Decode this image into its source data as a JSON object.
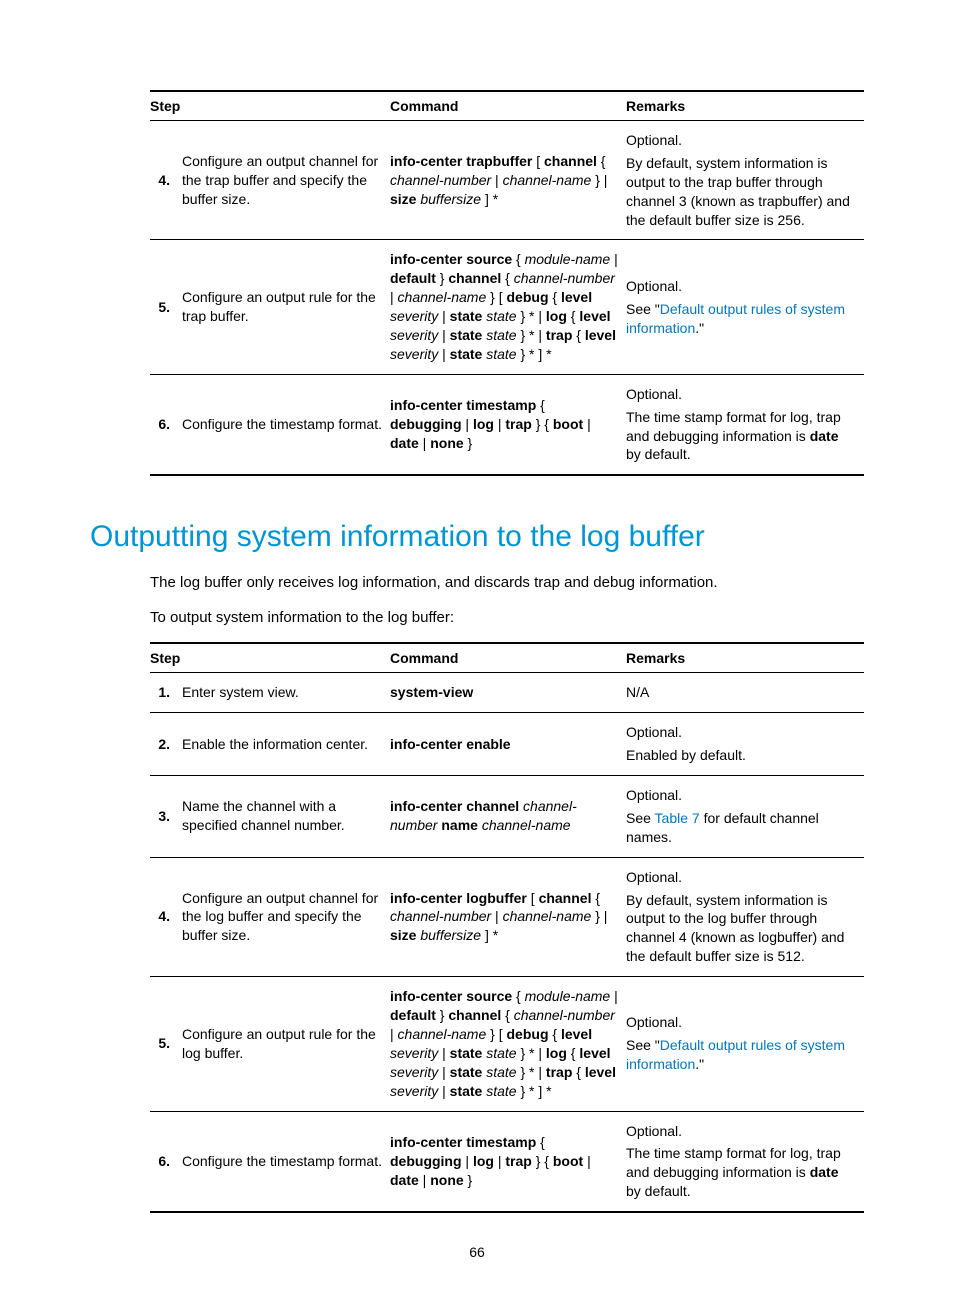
{
  "table1": {
    "headers": {
      "step": "Step",
      "command": "Command",
      "remarks": "Remarks"
    },
    "rows": [
      {
        "num": "4.",
        "desc": "Configure an output channel for the trap buffer and specify the buffer size.",
        "cmd": {
          "tokens": [
            {
              "t": "info-center trapbuffer",
              "b": 1
            },
            {
              "t": " [ "
            },
            {
              "t": "channel",
              "b": 1
            },
            {
              "t": " { "
            },
            {
              "t": "channel-number",
              "i": 1
            },
            {
              "t": " | "
            },
            {
              "t": "channel-name",
              "i": 1
            },
            {
              "t": " } "
            },
            {
              "t": " | "
            },
            {
              "t": "size",
              "b": 1
            },
            {
              "t": " "
            },
            {
              "t": "buffersize",
              "i": 1
            },
            {
              "t": " ] *"
            }
          ]
        },
        "remarks": [
          {
            "type": "p",
            "text": "Optional."
          },
          {
            "type": "p",
            "text": "By default, system information is output to the trap buffer through channel 3 (known as trapbuffer) and the default buffer size is 256."
          }
        ]
      },
      {
        "num": "5.",
        "desc": "Configure an output rule for the trap buffer.",
        "cmd": {
          "tokens": [
            {
              "t": "info-center source",
              "b": 1
            },
            {
              "t": " { "
            },
            {
              "t": "module-name",
              "i": 1
            },
            {
              "t": " | "
            },
            {
              "t": "default",
              "b": 1
            },
            {
              "t": " } "
            },
            {
              "t": "channel",
              "b": 1
            },
            {
              "t": " { "
            },
            {
              "t": "channel-number",
              "i": 1
            },
            {
              "t": " | "
            },
            {
              "t": "channel-name",
              "i": 1
            },
            {
              "t": " } [ "
            },
            {
              "t": "debug",
              "b": 1
            },
            {
              "t": " { "
            },
            {
              "t": "level",
              "b": 1
            },
            {
              "t": " "
            },
            {
              "t": "severity",
              "i": 1
            },
            {
              "t": " | "
            },
            {
              "t": "state",
              "b": 1
            },
            {
              "t": " "
            },
            {
              "t": "state",
              "i": 1
            },
            {
              "t": " } * | "
            },
            {
              "t": "log",
              "b": 1
            },
            {
              "t": " { "
            },
            {
              "t": "level",
              "b": 1
            },
            {
              "t": " "
            },
            {
              "t": "severity",
              "i": 1
            },
            {
              "t": " | "
            },
            {
              "t": "state",
              "b": 1
            },
            {
              "t": " "
            },
            {
              "t": "state",
              "i": 1
            },
            {
              "t": " } * | "
            },
            {
              "t": "trap",
              "b": 1
            },
            {
              "t": " { "
            },
            {
              "t": "level",
              "b": 1
            },
            {
              "t": " "
            },
            {
              "t": "severity",
              "i": 1
            },
            {
              "t": " | "
            },
            {
              "t": "state",
              "b": 1
            },
            {
              "t": " "
            },
            {
              "t": "state",
              "i": 1
            },
            {
              "t": " } * ] *"
            }
          ]
        },
        "remarks": [
          {
            "type": "p",
            "text": "Optional."
          },
          {
            "type": "mixed",
            "parts": [
              {
                "text": "See \""
              },
              {
                "text": "Default output rules of system information",
                "link": true
              },
              {
                "text": ".\""
              }
            ]
          }
        ]
      },
      {
        "num": "6.",
        "desc": "Configure the timestamp format.",
        "cmd": {
          "tokens": [
            {
              "t": "info-center timestamp",
              "b": 1
            },
            {
              "t": " { "
            },
            {
              "t": "debugging",
              "b": 1
            },
            {
              "t": " | "
            },
            {
              "t": "log",
              "b": 1
            },
            {
              "t": " | "
            },
            {
              "t": "trap",
              "b": 1
            },
            {
              "t": " } { "
            },
            {
              "t": "boot",
              "b": 1
            },
            {
              "t": " | "
            },
            {
              "t": "date",
              "b": 1
            },
            {
              "t": " | "
            },
            {
              "t": "none",
              "b": 1
            },
            {
              "t": " }"
            }
          ]
        },
        "remarks": [
          {
            "type": "p",
            "text": "Optional."
          },
          {
            "type": "mixed",
            "parts": [
              {
                "text": "The time stamp format for log, trap and debugging information is "
              },
              {
                "text": "date",
                "b": true
              },
              {
                "text": " by default."
              }
            ]
          }
        ]
      }
    ]
  },
  "heading": "Outputting system information to the log buffer",
  "para1": "The log buffer only receives log information, and discards trap and debug information.",
  "para2": "To output system information to the log buffer:",
  "table2": {
    "headers": {
      "step": "Step",
      "command": "Command",
      "remarks": "Remarks"
    },
    "rows": [
      {
        "num": "1.",
        "desc": "Enter system view.",
        "cmd": {
          "tokens": [
            {
              "t": "system-view",
              "b": 1
            }
          ]
        },
        "remarks": [
          {
            "type": "p",
            "text": "N/A"
          }
        ]
      },
      {
        "num": "2.",
        "desc": "Enable the information center.",
        "cmd": {
          "tokens": [
            {
              "t": "info-center enable",
              "b": 1
            }
          ]
        },
        "remarks": [
          {
            "type": "p",
            "text": "Optional."
          },
          {
            "type": "p",
            "text": "Enabled by default."
          }
        ]
      },
      {
        "num": "3.",
        "desc": "Name the channel with a specified channel number.",
        "cmd": {
          "tokens": [
            {
              "t": "info-center channel",
              "b": 1
            },
            {
              "t": " "
            },
            {
              "t": "channel-number",
              "i": 1
            },
            {
              "t": " "
            },
            {
              "t": "name",
              "b": 1
            },
            {
              "t": " "
            },
            {
              "t": "channel-name",
              "i": 1
            }
          ]
        },
        "remarks": [
          {
            "type": "p",
            "text": "Optional."
          },
          {
            "type": "mixed",
            "parts": [
              {
                "text": "See "
              },
              {
                "text": "Table 7",
                "link": true
              },
              {
                "text": " for default channel names."
              }
            ]
          }
        ]
      },
      {
        "num": "4.",
        "desc": "Configure an output channel for the log buffer and specify the buffer size.",
        "cmd": {
          "tokens": [
            {
              "t": "info-center logbuffer",
              "b": 1
            },
            {
              "t": " [ "
            },
            {
              "t": "channel",
              "b": 1
            },
            {
              "t": " { "
            },
            {
              "t": "channel-number",
              "i": 1
            },
            {
              "t": " | "
            },
            {
              "t": "channel-name",
              "i": 1
            },
            {
              "t": " } "
            },
            {
              "t": " | "
            },
            {
              "t": "size",
              "b": 1
            },
            {
              "t": " "
            },
            {
              "t": "buffersize",
              "i": 1
            },
            {
              "t": " ] *"
            }
          ]
        },
        "remarks": [
          {
            "type": "p",
            "text": "Optional."
          },
          {
            "type": "p",
            "text": "By default, system information is output to the log buffer through channel 4 (known as logbuffer) and the default buffer size is 512."
          }
        ]
      },
      {
        "num": "5.",
        "desc": "Configure an output rule for the log buffer.",
        "cmd": {
          "tokens": [
            {
              "t": "info-center source",
              "b": 1
            },
            {
              "t": " { "
            },
            {
              "t": "module-name",
              "i": 1
            },
            {
              "t": " | "
            },
            {
              "t": "default",
              "b": 1
            },
            {
              "t": " } "
            },
            {
              "t": "channel",
              "b": 1
            },
            {
              "t": " { "
            },
            {
              "t": "channel-number",
              "i": 1
            },
            {
              "t": " | "
            },
            {
              "t": "channel-name",
              "i": 1
            },
            {
              "t": " } [ "
            },
            {
              "t": "debug",
              "b": 1
            },
            {
              "t": " { "
            },
            {
              "t": "level",
              "b": 1
            },
            {
              "t": " "
            },
            {
              "t": "severity",
              "i": 1
            },
            {
              "t": " | "
            },
            {
              "t": "state",
              "b": 1
            },
            {
              "t": " "
            },
            {
              "t": "state",
              "i": 1
            },
            {
              "t": " } * | "
            },
            {
              "t": "log",
              "b": 1
            },
            {
              "t": " { "
            },
            {
              "t": "level",
              "b": 1
            },
            {
              "t": " "
            },
            {
              "t": "severity",
              "i": 1
            },
            {
              "t": " | "
            },
            {
              "t": "state",
              "b": 1
            },
            {
              "t": " "
            },
            {
              "t": "state",
              "i": 1
            },
            {
              "t": " } * | "
            },
            {
              "t": "trap",
              "b": 1
            },
            {
              "t": " { "
            },
            {
              "t": "level",
              "b": 1
            },
            {
              "t": " "
            },
            {
              "t": "severity",
              "i": 1
            },
            {
              "t": " | "
            },
            {
              "t": "state",
              "b": 1
            },
            {
              "t": " "
            },
            {
              "t": "state",
              "i": 1
            },
            {
              "t": " } * ] *"
            }
          ]
        },
        "remarks": [
          {
            "type": "p",
            "text": "Optional."
          },
          {
            "type": "mixed",
            "parts": [
              {
                "text": "See \""
              },
              {
                "text": "Default output rules of system information",
                "link": true
              },
              {
                "text": ".\""
              }
            ]
          }
        ]
      },
      {
        "num": "6.",
        "desc": "Configure the timestamp format.",
        "cmd": {
          "tokens": [
            {
              "t": "info-center timestamp",
              "b": 1
            },
            {
              "t": " { "
            },
            {
              "t": "debugging",
              "b": 1
            },
            {
              "t": " | "
            },
            {
              "t": "log",
              "b": 1
            },
            {
              "t": " | "
            },
            {
              "t": "trap",
              "b": 1
            },
            {
              "t": " } { "
            },
            {
              "t": "boot",
              "b": 1
            },
            {
              "t": " | "
            },
            {
              "t": "date",
              "b": 1
            },
            {
              "t": " | "
            },
            {
              "t": "none",
              "b": 1
            },
            {
              "t": " }"
            }
          ]
        },
        "remarks": [
          {
            "type": "p",
            "text": "Optional."
          },
          {
            "type": "mixed",
            "parts": [
              {
                "text": "The time stamp format for log, trap and debugging information is "
              },
              {
                "text": "date",
                "b": true
              },
              {
                "text": " by default."
              }
            ]
          }
        ]
      }
    ]
  },
  "pagenum": "66"
}
